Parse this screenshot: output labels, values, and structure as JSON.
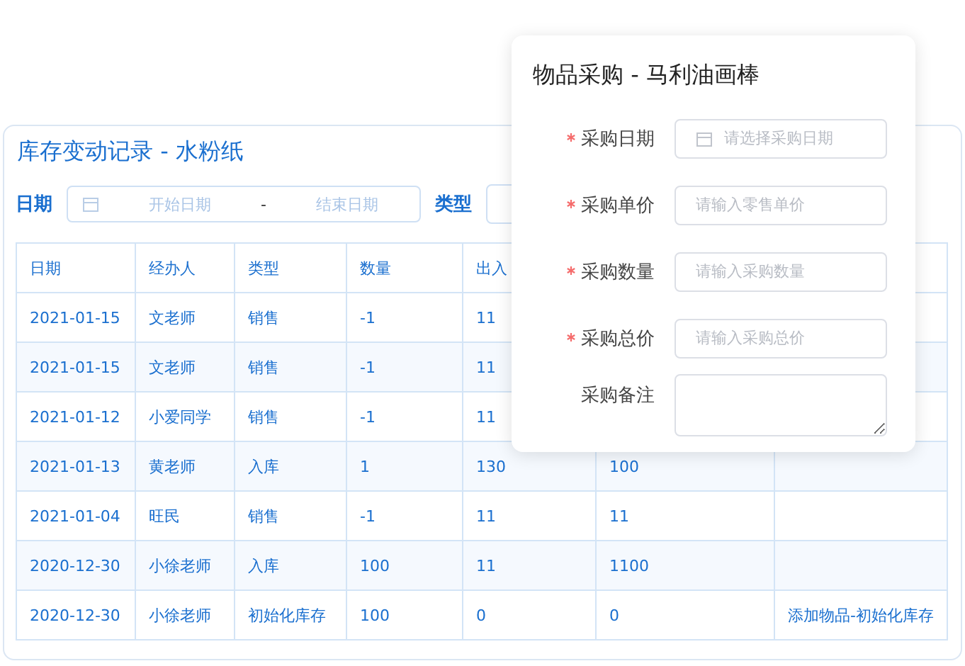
{
  "card": {
    "title": "库存变动记录 - 水粉纸"
  },
  "filters": {
    "date_label": "日期",
    "start_placeholder": "开始日期",
    "separator": "-",
    "end_placeholder": "结束日期",
    "type_label": "类型"
  },
  "table": {
    "columns": [
      "日期",
      "经办人",
      "类型",
      "数量",
      "出入"
    ],
    "rows": [
      {
        "cells": [
          "2021-01-15",
          "文老师",
          "销售",
          "-1",
          "11",
          null,
          null
        ]
      },
      {
        "cells": [
          "2021-01-15",
          "文老师",
          "销售",
          "-1",
          "11",
          null,
          null
        ]
      },
      {
        "cells": [
          "2021-01-12",
          "小爱同学",
          "销售",
          "-1",
          "11",
          null,
          null
        ]
      },
      {
        "cells": [
          "2021-01-13",
          "黄老师",
          "入库",
          "1",
          "130",
          "100",
          null
        ]
      },
      {
        "cells": [
          "2021-01-04",
          "旺民",
          "销售",
          "-1",
          "11",
          "11",
          null
        ]
      },
      {
        "cells": [
          "2020-12-30",
          "小徐老师",
          "入库",
          "100",
          "11",
          "1100",
          null
        ]
      },
      {
        "cells": [
          "2020-12-30",
          "小徐老师",
          "初始化库存",
          "100",
          "0",
          "0",
          "添加物品-初始化库存"
        ]
      }
    ]
  },
  "dialog": {
    "title": "物品采购 - 马利油画棒",
    "fields": [
      {
        "kind": "date",
        "required": true,
        "label": "采购日期",
        "placeholder": "请选择采购日期"
      },
      {
        "kind": "input",
        "required": true,
        "label": "采购单价",
        "placeholder": "请输入零售单价"
      },
      {
        "kind": "input",
        "required": true,
        "label": "采购数量",
        "placeholder": "请输入采购数量"
      },
      {
        "kind": "input",
        "required": true,
        "label": "采购总价",
        "placeholder": "请输入采购总价"
      },
      {
        "kind": "textarea",
        "required": false,
        "label": "采购备注"
      }
    ]
  }
}
